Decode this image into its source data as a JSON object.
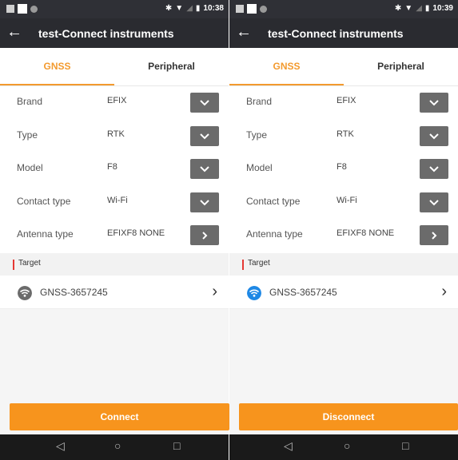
{
  "colors": {
    "accent": "#f7941d",
    "tab_active": "#f39a2e",
    "title_bg": "#2a2b30",
    "status_bg": "#2f3036",
    "wifi_left": "#6b6b6b",
    "wifi_right": "#1e88e5"
  },
  "screens": [
    {
      "status": {
        "time": "10:38"
      },
      "title": "test-Connect instruments",
      "tabs": [
        {
          "label": "GNSS"
        },
        {
          "label": "Peripheral"
        }
      ],
      "fields": [
        {
          "label": "Brand",
          "value": "EFIX",
          "control": "chevron-down-icon"
        },
        {
          "label": "Type",
          "value": "RTK",
          "control": "chevron-down-icon"
        },
        {
          "label": "Model",
          "value": "F8",
          "control": "chevron-down-icon"
        },
        {
          "label": "Contact type",
          "value": "Wi-Fi",
          "control": "chevron-down-icon"
        },
        {
          "label": "Antenna type",
          "value": "EFIXF8 NONE",
          "control": "chevron-right-icon"
        }
      ],
      "target_section": "Target",
      "target": {
        "name": "GNSS-3657245",
        "icon": "wifi-icon"
      },
      "action": "Connect"
    },
    {
      "status": {
        "time": "10:39"
      },
      "title": "test-Connect instruments",
      "tabs": [
        {
          "label": "GNSS"
        },
        {
          "label": "Peripheral"
        }
      ],
      "fields": [
        {
          "label": "Brand",
          "value": "EFIX",
          "control": "chevron-down-icon"
        },
        {
          "label": "Type",
          "value": "RTK",
          "control": "chevron-down-icon"
        },
        {
          "label": "Model",
          "value": "F8",
          "control": "chevron-down-icon"
        },
        {
          "label": "Contact type",
          "value": "Wi-Fi",
          "control": "chevron-down-icon"
        },
        {
          "label": "Antenna type",
          "value": "EFIXF8 NONE",
          "control": "chevron-right-icon"
        }
      ],
      "target_section": "Target",
      "target": {
        "name": "GNSS-3657245",
        "icon": "wifi-icon"
      },
      "action": "Disconnect"
    }
  ]
}
